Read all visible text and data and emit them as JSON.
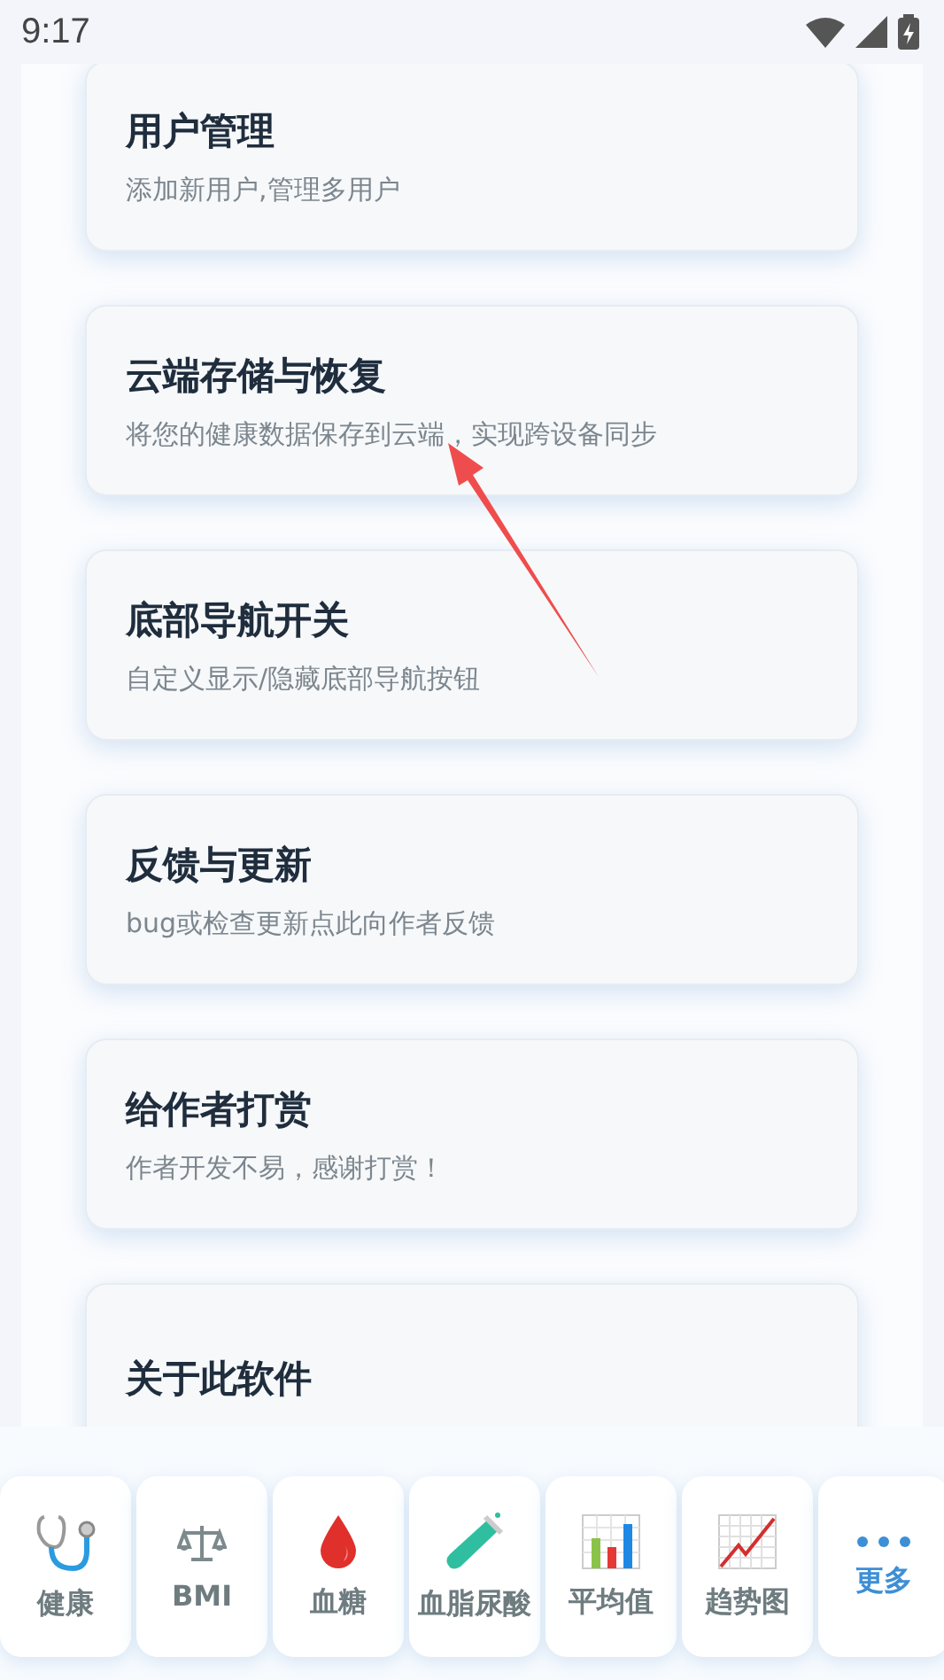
{
  "status_bar": {
    "time": "9:17"
  },
  "settings": [
    {
      "title": "用户管理",
      "subtitle": "添加新用户,管理多用户"
    },
    {
      "title": "云端存储与恢复",
      "subtitle": "将您的健康数据保存到云端，实现跨设备同步"
    },
    {
      "title": "底部导航开关",
      "subtitle": "自定义显示/隐藏底部导航按钮"
    },
    {
      "title": "反馈与更新",
      "subtitle": "bug或检查更新点此向作者反馈"
    },
    {
      "title": "给作者打赏",
      "subtitle": "作者开发不易，感谢打赏！"
    },
    {
      "title": "关于此软件"
    }
  ],
  "bottom_nav": [
    {
      "label": "健康",
      "kind": "stethoscope"
    },
    {
      "label": "BMI",
      "kind": "scale"
    },
    {
      "label": "血糖",
      "kind": "drop"
    },
    {
      "label": "血脂尿酸",
      "kind": "tube"
    },
    {
      "label": "平均值",
      "kind": "bars"
    },
    {
      "label": "趋势图",
      "kind": "trend"
    },
    {
      "label": "更多",
      "kind": "more"
    }
  ]
}
